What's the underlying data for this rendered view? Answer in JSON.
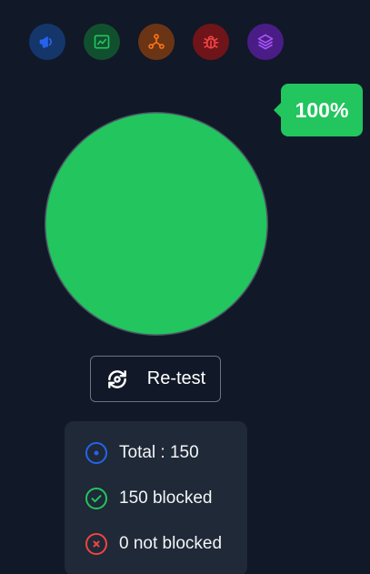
{
  "icons": [
    {
      "name": "megaphone-icon",
      "color": "#2563eb",
      "bg": "#14366b"
    },
    {
      "name": "chart-line-icon",
      "color": "#22c55e",
      "bg": "#11502e"
    },
    {
      "name": "network-icon",
      "color": "#f97316",
      "bg": "#6b3515"
    },
    {
      "name": "bug-icon",
      "color": "#ef4444",
      "bg": "#6f1519"
    },
    {
      "name": "layers-icon",
      "color": "#a855f7",
      "bg": "#4a1d86"
    }
  ],
  "progress": {
    "label": "100%",
    "value": 1.0,
    "fill_color": "#22c55e",
    "track_color": "#4b5563"
  },
  "retest": {
    "label": "Re-test",
    "icon": "refresh-icon"
  },
  "stats": {
    "total_label": "Total : 150",
    "blocked_label": "150 blocked",
    "not_blocked_label": "0 not blocked",
    "colors": {
      "total": "#2563eb",
      "blocked": "#22c55e",
      "not_blocked": "#ef4444"
    }
  }
}
